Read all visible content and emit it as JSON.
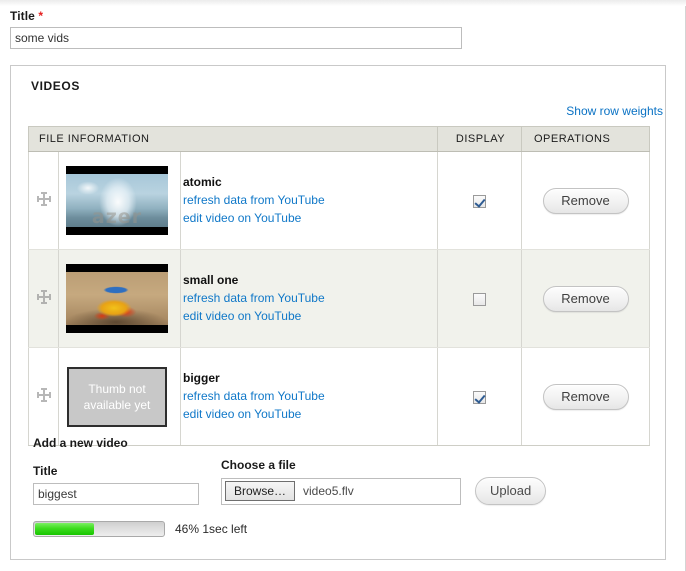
{
  "form": {
    "title_field": {
      "label": "Title",
      "required_marker": "*",
      "value": "some vids",
      "placeholder": ""
    }
  },
  "videos_fieldset": {
    "legend": "VIDEOS",
    "row_weights_link": "Show row weights",
    "table": {
      "columns": [
        "FILE INFORMATION",
        "DISPLAY",
        "OPERATIONS"
      ],
      "rows": [
        {
          "drag_handle": "move-cross-icon",
          "thumb_type": "image",
          "thumb_watermark": "azer",
          "name": "atomic",
          "link_refresh": "refresh data from YouTube",
          "link_edit": "edit video on YouTube",
          "display_checked": true,
          "operation_label": "Remove"
        },
        {
          "drag_handle": "move-cross-icon",
          "thumb_type": "image",
          "thumb_watermark": "",
          "name": "small one",
          "link_refresh": "refresh data from YouTube",
          "link_edit": "edit video on YouTube",
          "display_checked": false,
          "operation_label": "Remove"
        },
        {
          "drag_handle": "move-cross-icon",
          "thumb_type": "placeholder",
          "thumb_placeholder_line1": "Thumb not",
          "thumb_placeholder_line2": "available yet",
          "name": "bigger",
          "link_refresh": "refresh data from YouTube",
          "link_edit": "edit video on YouTube",
          "display_checked": true,
          "operation_label": "Remove"
        }
      ]
    },
    "add_new": {
      "heading": "Add a new video",
      "title_label": "Title",
      "title_value": "biggest",
      "title_placeholder": "",
      "file_label": "Choose a file",
      "browse_label": "Browse…",
      "file_name": "video5.flv",
      "upload_label": "Upload"
    },
    "progress": {
      "percent": 46,
      "percent_text": "46%",
      "time_left_text": "1sec left",
      "message": "46% 1sec left",
      "bar_color": "#24d106",
      "track_color": "#dedede"
    }
  },
  "colors": {
    "link": "#1078c8",
    "required": "#e52020",
    "table_header_bg": "#e3e3dc",
    "row_even_bg": "#f1f2ec",
    "fieldset_border": "#c9c9c9"
  }
}
